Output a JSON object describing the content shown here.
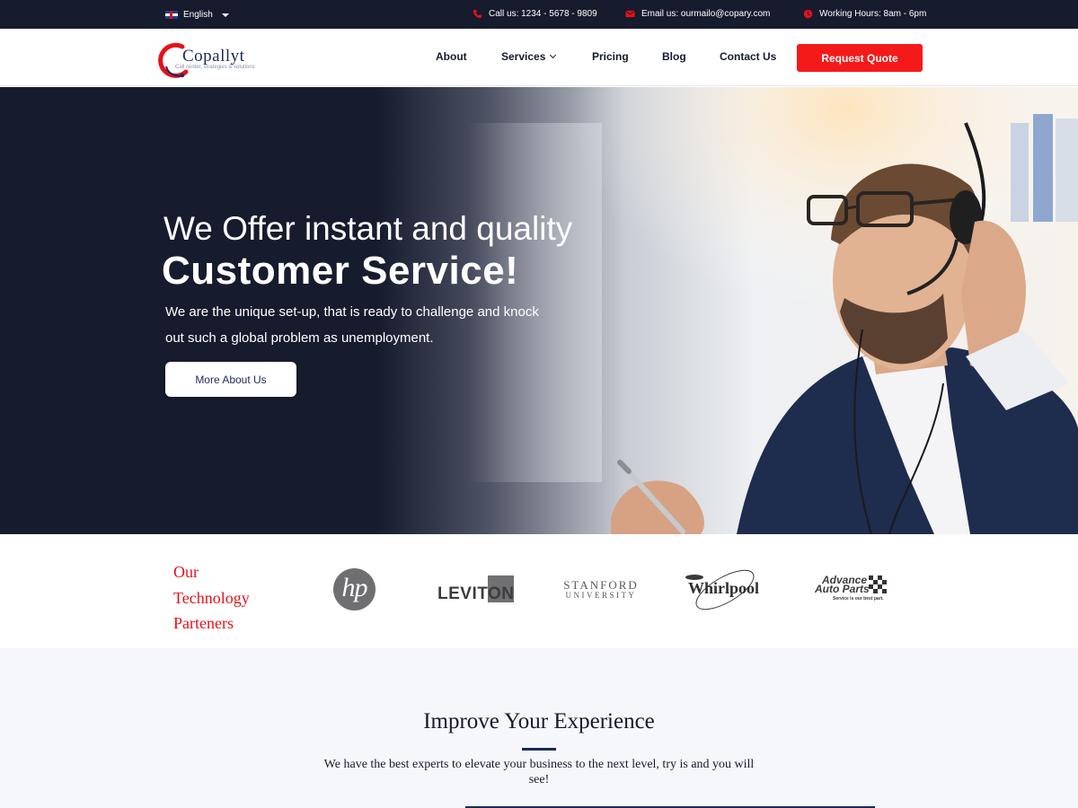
{
  "topbar": {
    "language": "English",
    "phone": "Call us: 1234 - 5678 - 9809",
    "email": "Email us: ourmailo@copary.com",
    "hours": "Working Hours: 8am - 6pm"
  },
  "header": {
    "logo_name": "Copallyt",
    "logo_tagline": "Call center, strategies & solutions",
    "nav": [
      "About",
      "Services",
      "Pricing",
      "Blog",
      "Contact Us"
    ],
    "cta": "Request Quote"
  },
  "hero": {
    "line1": "We Offer instant and quality",
    "line2": "Customer Service!",
    "subtitle": "We are the unique set-up, that is ready to challenge and knock out such a global problem as unemployment.",
    "button": "More About Us"
  },
  "partners": {
    "title_lines": [
      "Our",
      "Technology",
      "Parteners"
    ],
    "logos": {
      "hp": "hp",
      "leviton": "LEVITON",
      "stanford_1": "STANFORD",
      "stanford_2": "UNIVERSITY",
      "whirlpool": "Whirlpool",
      "advance_1": "Advance",
      "advance_2": "Auto Parts",
      "advance_3": "Service is our best part."
    }
  },
  "improve": {
    "title": "Improve Your Experience",
    "text": "We have the best experts to elevate your business to the next level, try is and you will see!"
  },
  "colors": {
    "navy": "#161b2d",
    "red": "#f41a1a",
    "brand_blue": "#1b2a5c"
  }
}
